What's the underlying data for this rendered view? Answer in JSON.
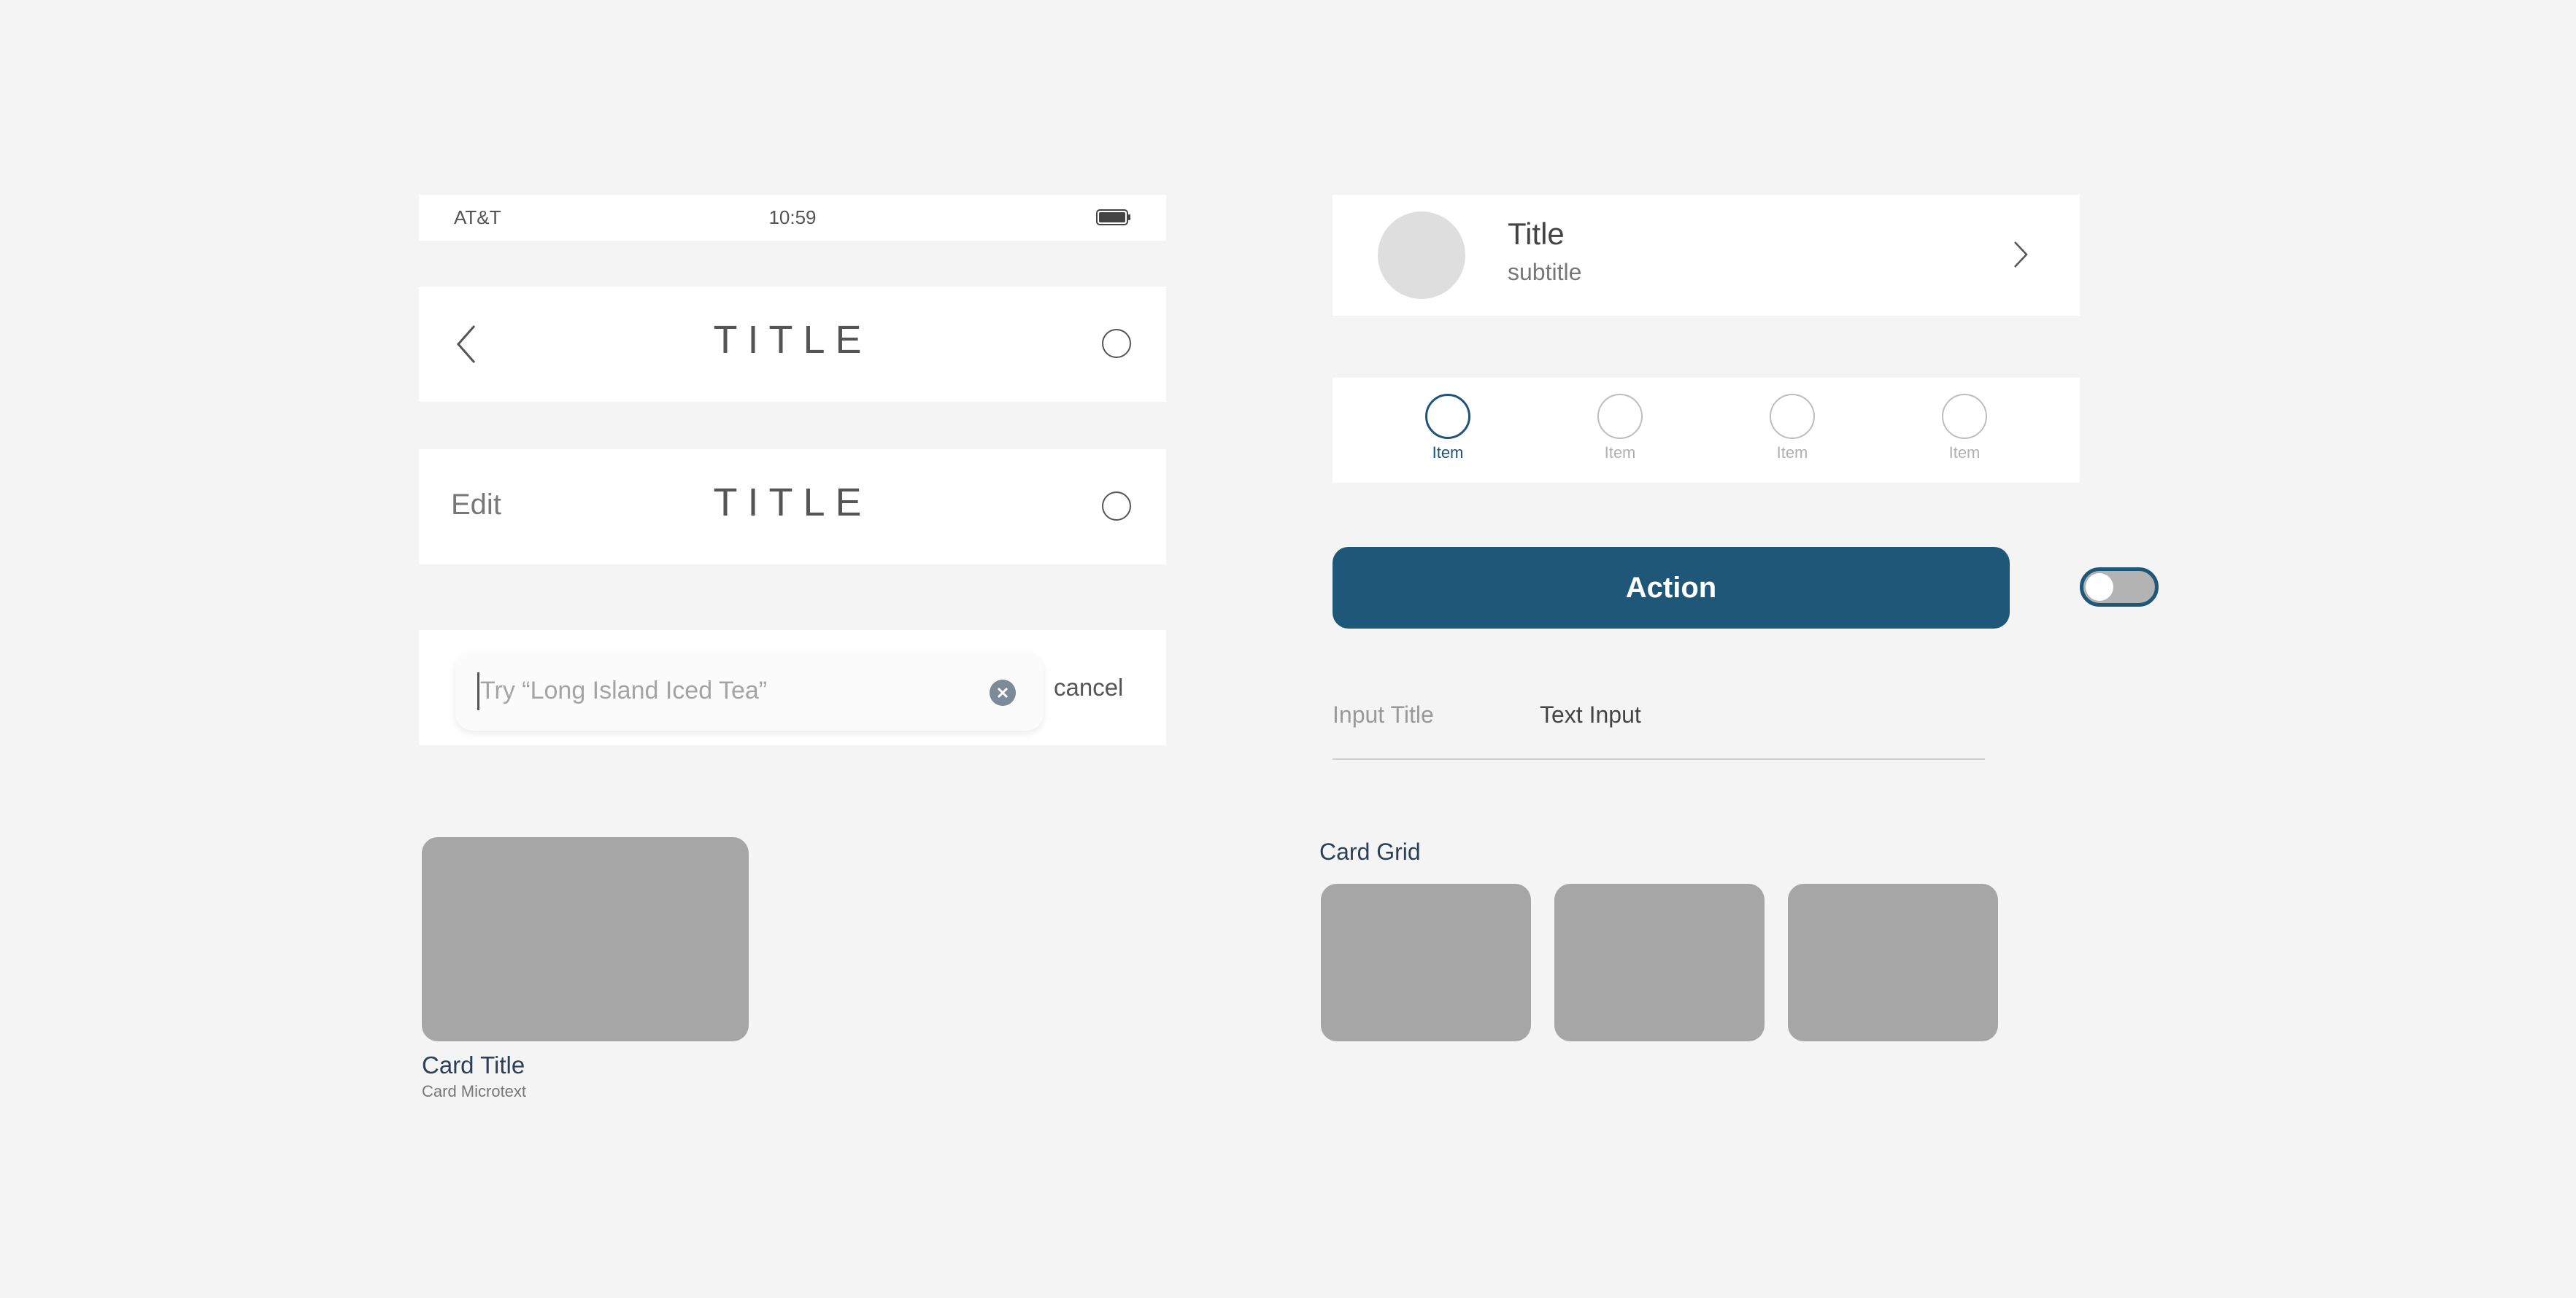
{
  "status_bar": {
    "carrier": "AT&T",
    "time": "10:59",
    "battery_icon": "battery-icon"
  },
  "nav_bar_back": {
    "back_icon": "chevron-left-icon",
    "title": "TITLE",
    "right_icon": "circle-icon"
  },
  "nav_bar_edit": {
    "edit_label": "Edit",
    "title": "TITLE",
    "right_icon": "circle-icon"
  },
  "search": {
    "placeholder": "Try “Long Island Iced Tea”",
    "clear_icon": "clear-x-icon",
    "cancel_label": "cancel"
  },
  "card": {
    "title": "Card Title",
    "microtext": "Card Microtext"
  },
  "list_item": {
    "title": "Title",
    "subtitle": "subtitle",
    "chevron_icon": "chevron-right-icon"
  },
  "tab_bar": {
    "items": [
      {
        "label": "Item",
        "active": true
      },
      {
        "label": "Item",
        "active": false
      },
      {
        "label": "Item",
        "active": false
      },
      {
        "label": "Item",
        "active": false
      }
    ]
  },
  "action_button": {
    "label": "Action"
  },
  "toggle": {
    "state": "off"
  },
  "text_input": {
    "title": "Input Title",
    "value": "Text Input"
  },
  "card_grid": {
    "label": "Card Grid"
  },
  "colors": {
    "background": "#f4f4f4",
    "accent": "#1f5778",
    "card_placeholder": "#a6a6a6"
  }
}
